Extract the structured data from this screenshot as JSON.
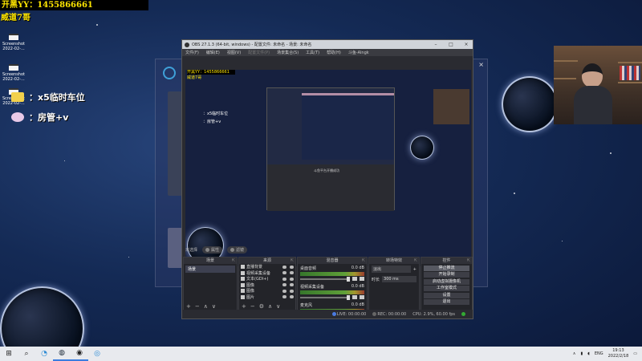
{
  "overlay": {
    "banner": "开黑YY：1455866661",
    "handle": "威道7哥",
    "badges": [
      {
        "text": "：x5临时车位",
        "color": "#f2d04c"
      },
      {
        "text": "：房管+v",
        "color": "#e8c9e8"
      }
    ]
  },
  "desktop_icons": [
    {
      "name": "Screenshot",
      "date": "2022-02-..."
    },
    {
      "name": "Screenshot",
      "date": "2022-02-..."
    },
    {
      "name": "Screenshot",
      "date": "2022-02-..."
    }
  ],
  "obs": {
    "title": "OBS 27.1.3 (64-bit, windows) - 配置文件: 未命名 - 场景: 未命名",
    "menu": [
      "文件(F)",
      "编辑(E)",
      "视图(V)",
      "配置文件(P)",
      "场景集合(S)",
      "工具(T)",
      "帮助(H)",
      "斗鱼-Alngk"
    ],
    "menu_disabled_index": 3,
    "scene_bar": {
      "label": "未选择",
      "btn1": "属性",
      "btn2": "滤镜"
    },
    "docks": {
      "scenes": {
        "title": "场景",
        "items": [
          "场景"
        ]
      },
      "sources": {
        "title": "来源",
        "items": [
          "直播背景",
          "视频采集设备",
          "文本(GDI+)",
          "图像",
          "图像",
          "图片"
        ]
      },
      "mixer": {
        "title": "混音器",
        "channels": [
          {
            "name": "桌面音频",
            "db": "0.0 dB"
          },
          {
            "name": "视频采集设备",
            "db": "0.0 dB"
          },
          {
            "name": "麦克风",
            "db": "0.0 dB"
          }
        ]
      },
      "transitions": {
        "title": "转场特效",
        "effect": "淡出",
        "duration_label": "时长",
        "duration": "300 ms"
      },
      "controls": {
        "title": "控件",
        "buttons": [
          "停止推流",
          "开始录制",
          "启动虚拟摄像机",
          "工作室模式",
          "设置",
          "退出"
        ]
      }
    },
    "status": {
      "live": "LIVE: 00:00:00",
      "rec": "REC: 00:00:00",
      "cpu": "CPU: 2.9%, 60.00 fps"
    },
    "nested_caption": "斗鱼平台开播成功"
  },
  "taskbar": {
    "items": [
      "start-icon",
      "search-icon",
      "edge-icon",
      "steam-icon",
      "obs-icon",
      "app-icon"
    ],
    "lang": "ENG",
    "time": "19:13",
    "date": "2022/2/18"
  },
  "colors": {
    "overlay_yellow": "#ffe600",
    "obs_bg": "#2a2b31",
    "desktop": "#142a55"
  }
}
